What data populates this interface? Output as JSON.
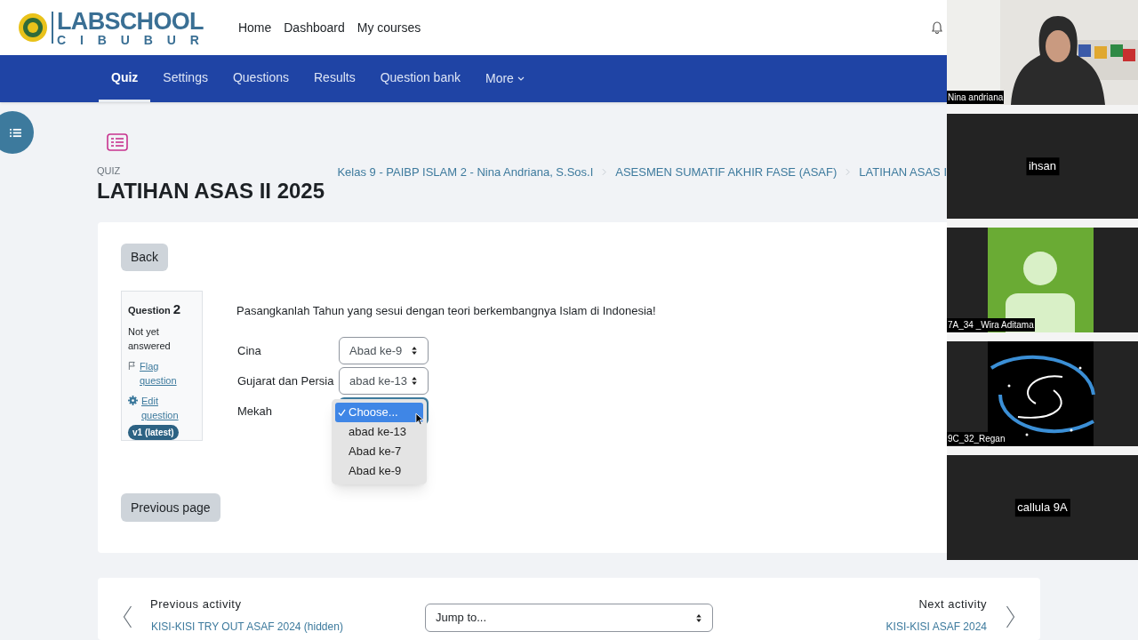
{
  "header": {
    "logo": {
      "line1": "LABSCHOOL",
      "line2": "C I B U B U R"
    },
    "nav_links": [
      "Home",
      "Dashboard",
      "My courses"
    ]
  },
  "secondary_nav": {
    "tabs": [
      {
        "label": "Quiz",
        "selected": true
      },
      {
        "label": "Settings",
        "selected": false
      },
      {
        "label": "Questions",
        "selected": false
      },
      {
        "label": "Results",
        "selected": false
      },
      {
        "label": "Question bank",
        "selected": false
      }
    ],
    "more": "More"
  },
  "page": {
    "kind_label": "QUIZ",
    "title": "LATIHAN ASAS II 2025",
    "breadcrumbs": [
      "Kelas 9 - PAIBP ISLAM 2 - Nina Andriana, S.Sos.I",
      "ASESMEN SUMATIF AKHIR FASE (ASAF)",
      "LATIHAN ASAS I"
    ]
  },
  "back_button": "Back",
  "question_info": {
    "label": "Question",
    "number": "2",
    "status": "Not yet answered",
    "flag_link": "Flag question",
    "edit_link": "Edit question",
    "version": "v1 (latest)"
  },
  "prompt": "Pasangkanlah Tahun yang sesui dengan teori berkembangnya Islam di Indonesia!",
  "matches": [
    {
      "label": "Cina",
      "value": "Abad ke-9"
    },
    {
      "label": "Gujarat dan Persia",
      "value": "abad ke-13"
    },
    {
      "label": "Mekah",
      "options": [
        {
          "label": "Choose...",
          "selected": true
        },
        {
          "label": "abad ke-13",
          "selected": false
        },
        {
          "label": "Abad ke-7",
          "selected": false
        },
        {
          "label": "Abad ke-9",
          "selected": false
        }
      ]
    }
  ],
  "previous_page_button": "Previous page",
  "activity_nav": {
    "previous": {
      "heading": "Previous activity",
      "link": "KISI-KISI TRY OUT ASAF 2024 (hidden)"
    },
    "jump_placeholder": "Jump to...",
    "next": {
      "heading": "Next activity",
      "link": "KISI-KISI ASAF 2024"
    }
  },
  "video_tiles": [
    {
      "name": "Nina andriana",
      "kind": "camera"
    },
    {
      "name": "ihsan",
      "kind": "blank"
    },
    {
      "name": "7A_34 _Wira Aditama",
      "kind": "avatar"
    },
    {
      "name": "9C_32_Regan"
    },
    {
      "name": "callula 9A",
      "kind": "blank"
    }
  ]
}
